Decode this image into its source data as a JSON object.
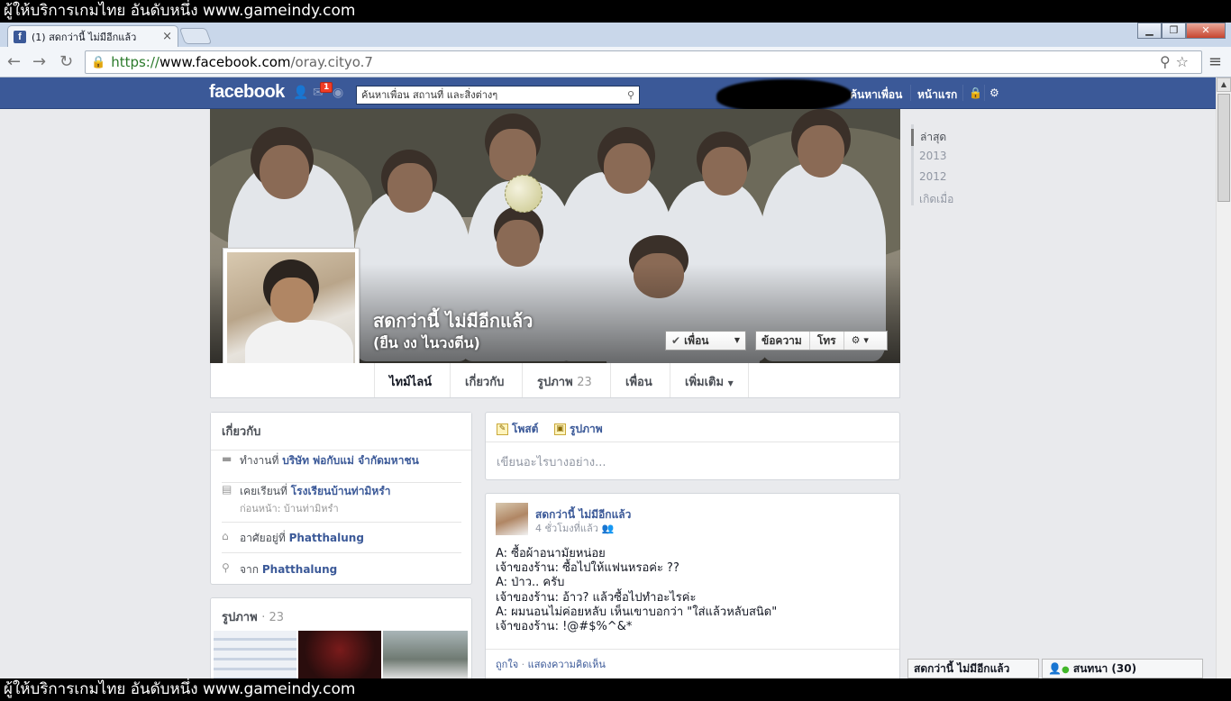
{
  "banner": {
    "text": "ผู้ให้บริการเกมไทย อันดับหนึ่ง www.gameindy.com"
  },
  "browser": {
    "tab_title": "(1) สดกว่านี้ ไม่มีอีกแล้ว",
    "tab_favicon": "f",
    "url_scheme": "https://",
    "url_host": "www.facebook.com",
    "url_path": "/oray.cityo.7"
  },
  "fb": {
    "logo": "facebook",
    "notification_count": "1",
    "search_placeholder": "ค้นหาเพื่อน สถานที่ และสิ่งต่างๆ",
    "nav_find_friends": "ค้นหาเพื่อน",
    "nav_home": "หน้าแรก"
  },
  "profile": {
    "name": "สดกว่านี้ ไม่มีอีกแล้ว",
    "alt_name": "(ยืน งง ไนวงตีน)",
    "btn_friends": "เพื่อน",
    "btn_message": "ข้อความ",
    "btn_call": "โทร"
  },
  "profile_nav": {
    "timeline": "ไทม์ไลน์",
    "about": "เกี่ยวกับ",
    "photos": "รูปภาพ",
    "photos_count": "23",
    "friends": "เพื่อน",
    "more": "เพิ่มเติม"
  },
  "about": {
    "title": "เกี่ยวกับ",
    "work_prefix": "ทำงานที่",
    "work_value": "บริษัท พ่อกับแม่ จำกัดมหาชน",
    "school_prefix": "เคยเรียนที่",
    "school_value": "โรงเรียนบ้านท่ามิหรำ",
    "school_sub": "ก่อนหน้า: บ้านท่ามิหรำ",
    "lives_prefix": "อาศัยอยู่ที่",
    "lives_value": "Phatthalung",
    "from_prefix": "จาก",
    "from_value": "Phatthalung"
  },
  "photos": {
    "title": "รูปภาพ",
    "count": "23"
  },
  "composer": {
    "tab_post": "โพสต์",
    "tab_photo": "รูปภาพ",
    "placeholder": "เขียนอะไรบางอย่าง..."
  },
  "post": {
    "author": "สดกว่านี้ ไม่มีอีกแล้ว",
    "time": "4 ชั่วโมงที่แล้ว",
    "lines": [
      "A: ซื้อผ้าอนามัยหน่อย",
      "เจ้าของร้าน: ซื้อไปให้แฟนหรอค่ะ ??",
      "A: ป่าว.. ครับ",
      "เจ้าของร้าน: อ้าว? แล้วซื้อไปทำอะไรค่ะ",
      "A: ผมนอนไม่ค่อยหลับ เห็นเขาบอกว่า \"ใส่แล้วหลับสนิด\"",
      "เจ้าของร้าน: !@#$%^&*"
    ],
    "like": "ถูกใจ",
    "comment": "แสดงความคิดเห็น"
  },
  "timeline_years": [
    "ล่าสุด",
    "2013",
    "2012",
    "เกิดเมื่อ"
  ],
  "chat": {
    "profile_tab": "สดกว่านี้ ไม่มีอีกแล้ว",
    "chat_label": "สนทนา (30)"
  },
  "colors": {
    "fb_blue": "#3b5998",
    "link": "#3b5998",
    "badge_red": "#f03d25"
  }
}
